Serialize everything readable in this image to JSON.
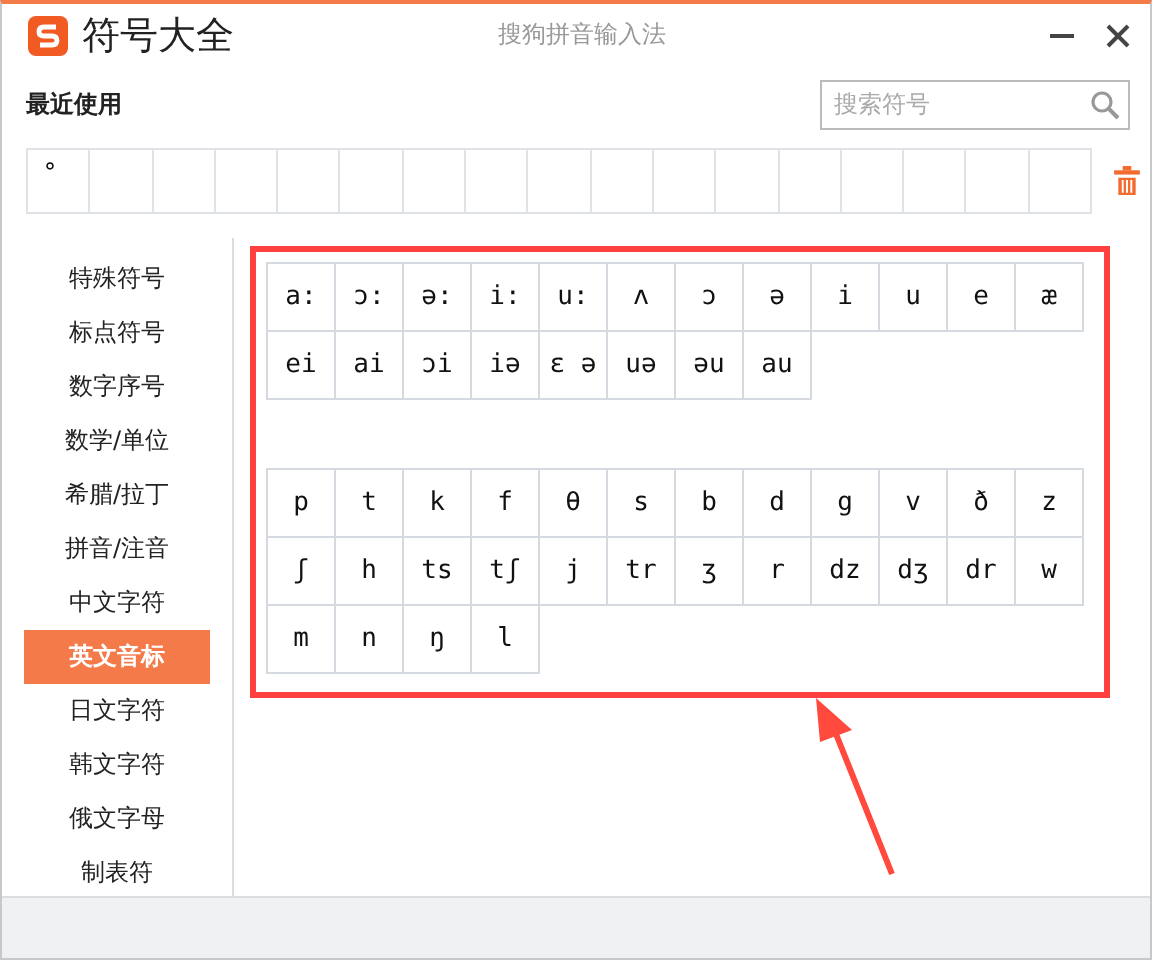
{
  "window": {
    "title": "符号大全",
    "subtitle": "搜狗拼音输入法"
  },
  "recent": {
    "label": "最近使用",
    "symbols": [
      "°"
    ]
  },
  "search": {
    "placeholder": "搜索符号"
  },
  "sidebar": {
    "items": [
      {
        "label": "特殊符号",
        "selected": false
      },
      {
        "label": "标点符号",
        "selected": false
      },
      {
        "label": "数字序号",
        "selected": false
      },
      {
        "label": "数学/单位",
        "selected": false
      },
      {
        "label": "希腊/拉丁",
        "selected": false
      },
      {
        "label": "拼音/注音",
        "selected": false
      },
      {
        "label": "中文字符",
        "selected": false
      },
      {
        "label": "英文音标",
        "selected": true
      },
      {
        "label": "日文字符",
        "selected": false
      },
      {
        "label": "韩文字符",
        "selected": false
      },
      {
        "label": "俄文字母",
        "selected": false
      },
      {
        "label": "制表符",
        "selected": false
      }
    ]
  },
  "groups": [
    [
      "a:",
      "ɔ:",
      "ə:",
      "i:",
      "u:",
      "ʌ",
      "ɔ",
      "ə",
      "i",
      "u",
      "e",
      "æ",
      "ei",
      "ai",
      "ɔi",
      "iə",
      "ɛ ə",
      "uə",
      "əu",
      "au"
    ],
    [
      "p",
      "t",
      "k",
      "f",
      "θ",
      "s",
      "b",
      "d",
      "g",
      "v",
      "ð",
      "z",
      "ʃ",
      "h",
      "ts",
      "tʃ",
      "j",
      "tr",
      "ʒ",
      "r",
      "dz",
      "dʒ",
      "dr",
      "w",
      "m",
      "n",
      "ŋ",
      "l"
    ]
  ]
}
